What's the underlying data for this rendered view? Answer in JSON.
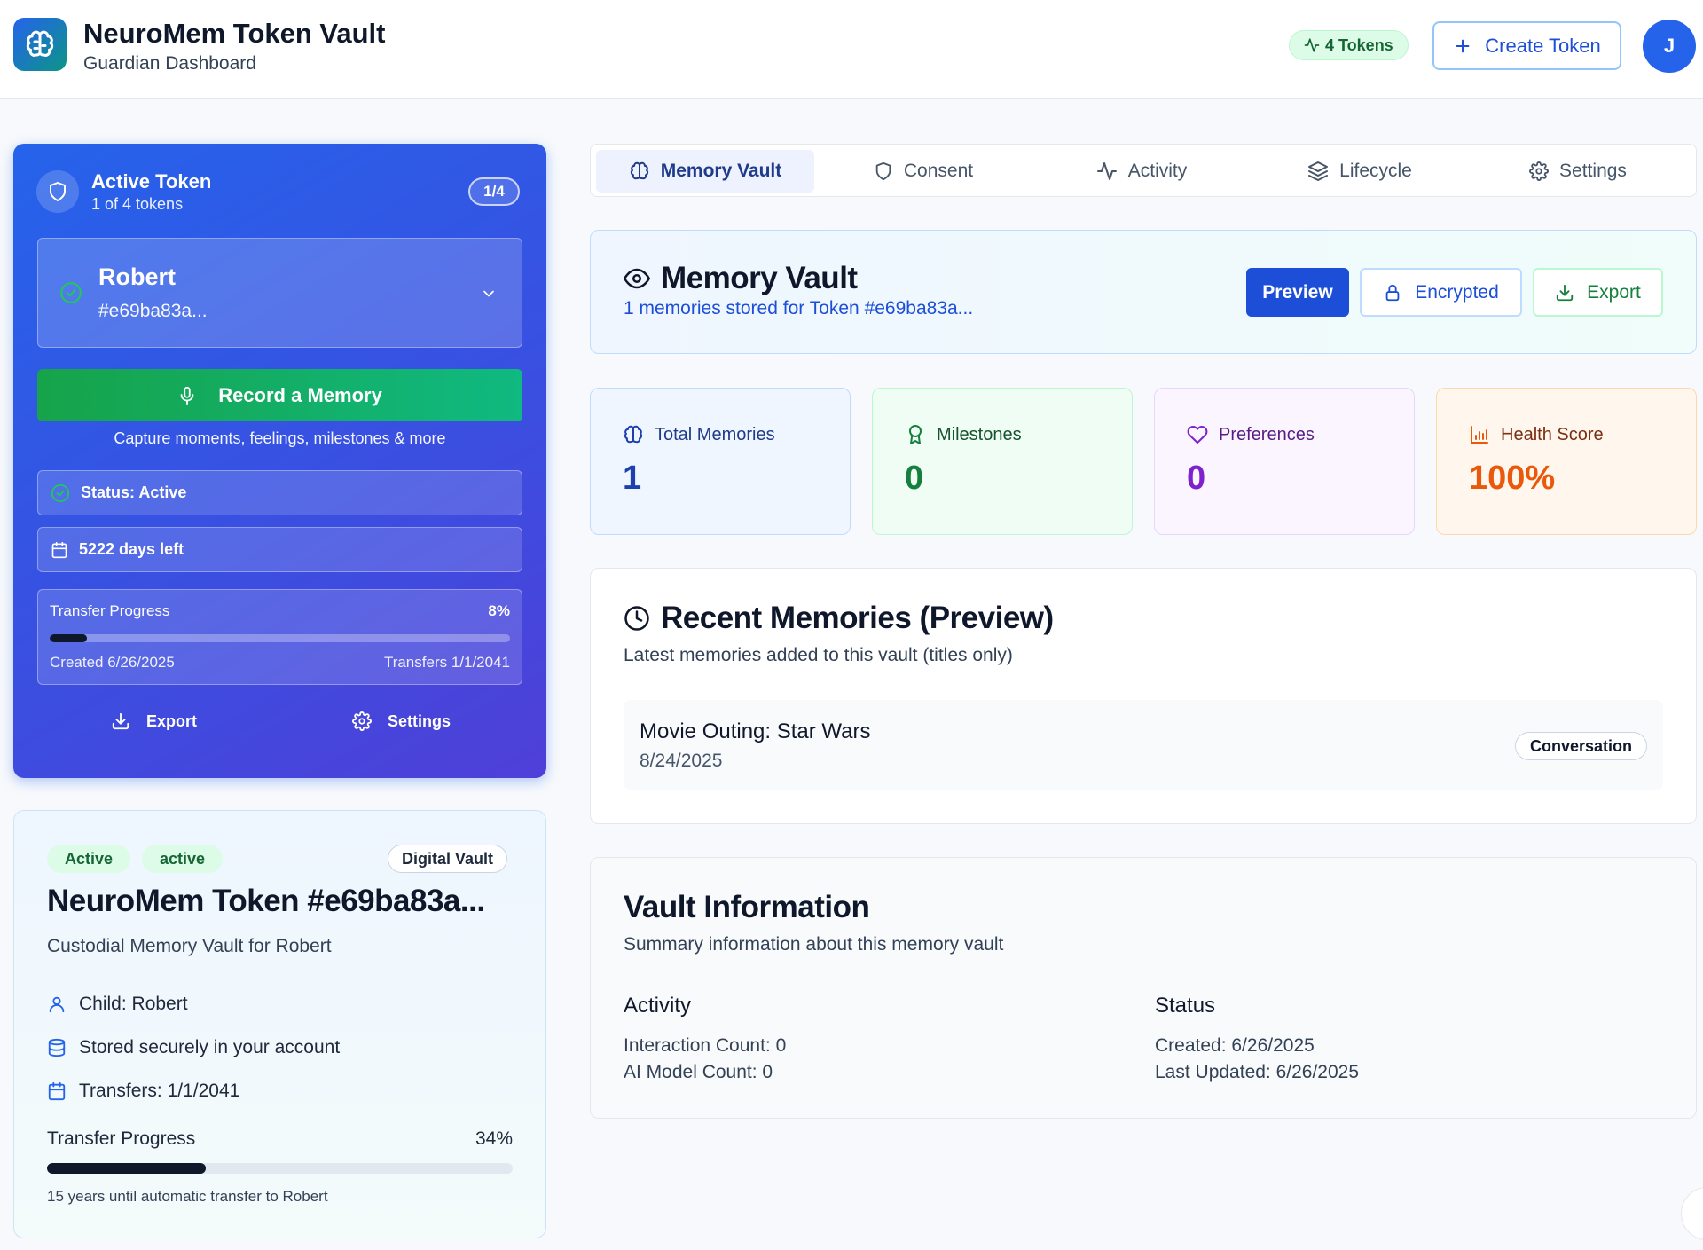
{
  "header": {
    "title": "NeuroMem Token Vault",
    "subtitle": "Guardian Dashboard",
    "tokens_badge": "4 Tokens",
    "create_button": "Create Token",
    "avatar_initial": "J"
  },
  "active_token": {
    "title": "Active Token",
    "subtitle": "1 of 4 tokens",
    "counter": "1/4",
    "selected_name": "Robert",
    "selected_hash": "#e69ba83a...",
    "record_button": "Record a Memory",
    "record_hint": "Capture moments, feelings, milestones & more",
    "status": "Status: Active",
    "days_left": "5222 days left",
    "progress": {
      "label": "Transfer Progress",
      "percent_text": "8%",
      "percent": 8,
      "created": "Created 6/26/2025",
      "transfers": "Transfers 1/1/2041"
    },
    "export_label": "Export",
    "settings_label": "Settings"
  },
  "token_info": {
    "badge_active": "Active",
    "badge_status": "active",
    "badge_type": "Digital Vault",
    "title": "NeuroMem Token #e69ba83a...",
    "subtitle": "Custodial Memory Vault for Robert",
    "child": "Child: Robert",
    "storage": "Stored securely in your account",
    "transfers": "Transfers: 1/1/2041",
    "progress_label": "Transfer Progress",
    "progress_percent_text": "34%",
    "progress_percent": 34,
    "progress_note": "15 years until automatic transfer to Robert"
  },
  "tabs": [
    {
      "label": "Memory Vault",
      "icon": "brain-icon"
    },
    {
      "label": "Consent",
      "icon": "shield-icon"
    },
    {
      "label": "Activity",
      "icon": "activity-icon"
    },
    {
      "label": "Lifecycle",
      "icon": "layers-icon"
    },
    {
      "label": "Settings",
      "icon": "gear-icon"
    }
  ],
  "memory_vault": {
    "title": "Memory Vault",
    "subtitle": "1 memories stored for Token #e69ba83a...",
    "preview_button": "Preview",
    "encrypted_button": "Encrypted",
    "export_button": "Export"
  },
  "stats": [
    {
      "label": "Total Memories",
      "value": "1",
      "icon": "brain-icon",
      "color": "#1e40af"
    },
    {
      "label": "Milestones",
      "value": "0",
      "icon": "award-icon",
      "color": "#15803d"
    },
    {
      "label": "Preferences",
      "value": "0",
      "icon": "heart-icon",
      "color": "#7e22ce"
    },
    {
      "label": "Health Score",
      "value": "100%",
      "icon": "bar-chart-icon",
      "color": "#ea580c"
    }
  ],
  "recent": {
    "title": "Recent Memories (Preview)",
    "subtitle": "Latest memories added to this vault (titles only)",
    "items": [
      {
        "title": "Movie Outing: Star Wars",
        "date": "8/24/2025",
        "badge": "Conversation"
      }
    ]
  },
  "vault_info": {
    "title": "Vault Information",
    "subtitle": "Summary information about this memory vault",
    "activity_heading": "Activity",
    "interaction_count": "Interaction Count: 0",
    "ai_model_count": "AI Model Count: 0",
    "status_heading": "Status",
    "created": "Created: 6/26/2025",
    "last_updated": "Last Updated: 6/26/2025"
  },
  "colors": {
    "primary": "#2563eb",
    "success": "#16a34a",
    "purple": "#7e22ce",
    "orange": "#ea580c"
  }
}
